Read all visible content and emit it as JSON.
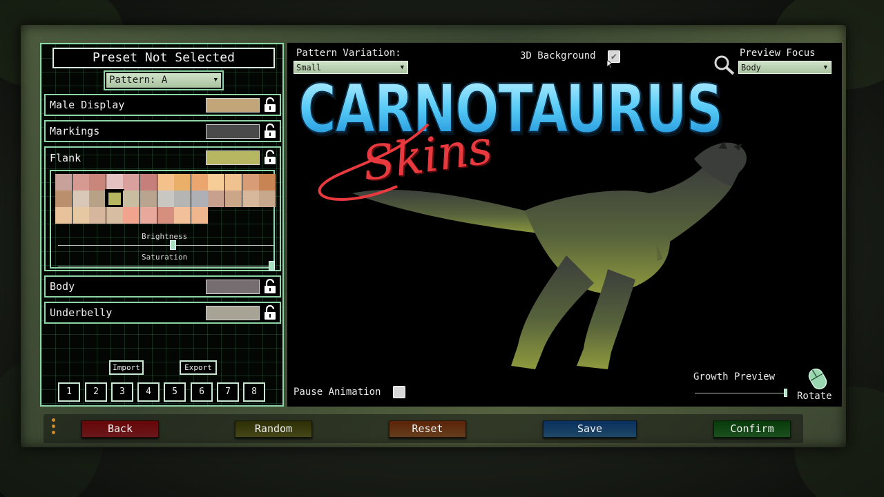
{
  "left_panel": {
    "preset_title": "Preset Not Selected",
    "pattern_dropdown": "Pattern: A",
    "rows": [
      {
        "label": "Male Display",
        "color": "#c3a57a"
      },
      {
        "label": "Markings",
        "color": "#4a4a4a"
      },
      {
        "label": "Flank",
        "color": "#b6b760"
      },
      {
        "label": "Body",
        "color": "#766d70"
      },
      {
        "label": "Underbelly",
        "color": "#a8a495"
      }
    ],
    "palette": [
      [
        "#c9a19b",
        "#d69a92",
        "#c9867a",
        "#e4c2c1",
        "#d8a19d",
        "#c77f7c",
        "#f4c08b",
        "#eab06a",
        "#eaa66e",
        "#f6cc97",
        "#f0c28f",
        "#d89d76",
        "#c88553"
      ],
      [
        "#b98f6e",
        "#d9c8b7",
        "#b7a288",
        "#b6b760",
        "#c8bda1",
        "#b8a48f",
        "#c9c7c2",
        "#b5b5b4",
        "#aeb0b6",
        "#c7a08e",
        "#cba787",
        "#d7b89c",
        "#c7a88c"
      ],
      [
        "#e8c29b",
        "#e6c8a2",
        "#d6b69c",
        "#d7bda1",
        "#f0a38d",
        "#e9a89c",
        "#d68f7f",
        "#f2c19a",
        "#f0b78e"
      ]
    ],
    "selected_swatch": "#b6b760",
    "brightness_label": "Brightness",
    "saturation_label": "Saturation",
    "brightness_value": 0.53,
    "saturation_value": 1.0,
    "import_label": "Import",
    "export_label": "Export",
    "slots": [
      "1",
      "2",
      "3",
      "4",
      "5",
      "6",
      "7",
      "8"
    ]
  },
  "preview": {
    "pattern_variation_label": "Pattern Variation:",
    "pattern_variation_value": "Small",
    "background_label": "3D Background",
    "background_checked": true,
    "focus_label": "Preview Focus",
    "focus_value": "Body",
    "title_main": "CARNOTAURUS",
    "title_script": "Skins",
    "pause_label": "Pause Animation",
    "pause_checked": false,
    "growth_label": "Growth Preview",
    "growth_value": 1.0,
    "rotate_label": "Rotate"
  },
  "bottom_bar": {
    "back": "Back",
    "random": "Random",
    "reset": "Reset",
    "save": "Save",
    "confirm": "Confirm"
  },
  "colors": {
    "accent": "#8fd6a6",
    "back": "#a2252b",
    "random": "#6a6d25",
    "reset": "#9a5f2c",
    "save": "#2f6f9c",
    "confirm": "#2b7a2f"
  }
}
